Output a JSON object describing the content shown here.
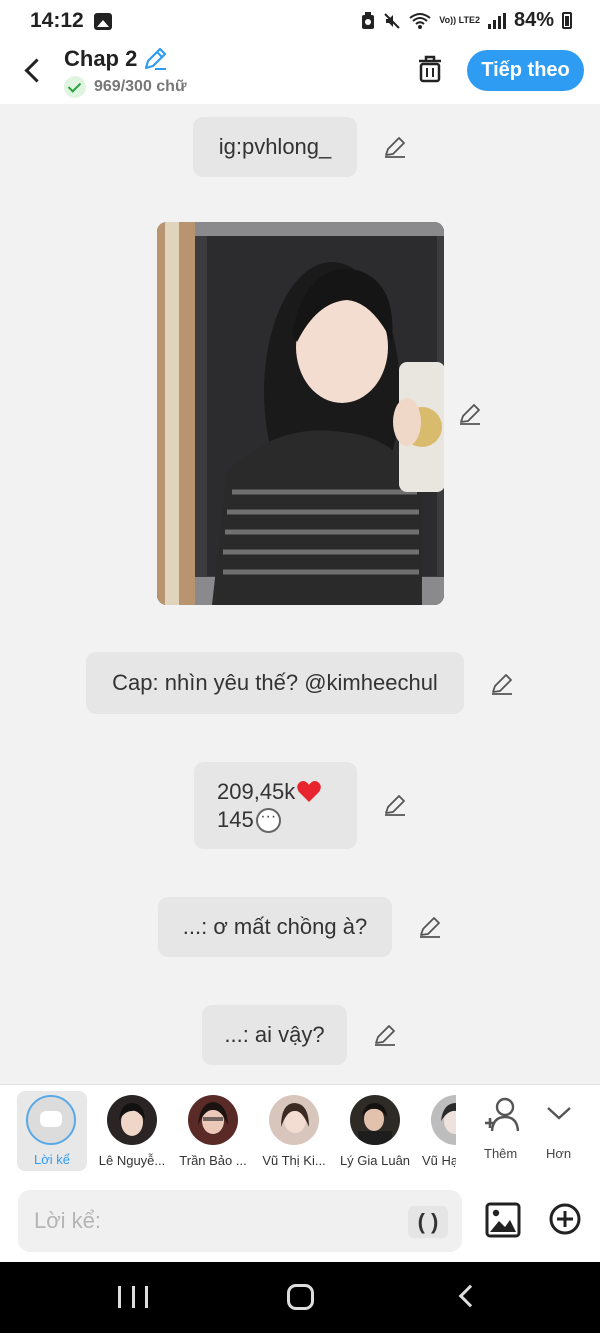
{
  "status_bar": {
    "time": "14:12",
    "network_label": "Vo)) LTE2",
    "battery": "84%"
  },
  "header": {
    "title": "Chap 2",
    "word_count": "969/300 chữ",
    "next_label": "Tiếp theo"
  },
  "messages": {
    "ig": "ig:pvhlong_",
    "caption": "Cap: nhìn yêu thế? @kimheechul",
    "likes": "209,45k",
    "comments": "145",
    "comment1": "...: ơ mất chồng à?",
    "comment2": "...: ai vậy?"
  },
  "characters": {
    "narrator_label": "Lời kể",
    "items": [
      {
        "name": "Lê Nguyễ..."
      },
      {
        "name": "Trần Bảo ..."
      },
      {
        "name": "Vũ Thị Ki..."
      },
      {
        "name": "Lý Gia Luân"
      },
      {
        "name": "Vũ Hạ"
      }
    ],
    "add_label": "Thêm",
    "more_label": "Hơn"
  },
  "input": {
    "placeholder": "Lời kể:",
    "paren_label": "( )"
  },
  "colors": {
    "accent": "#2d9cf2",
    "bubble": "#e6e6e6",
    "background": "#f2f2f2"
  }
}
